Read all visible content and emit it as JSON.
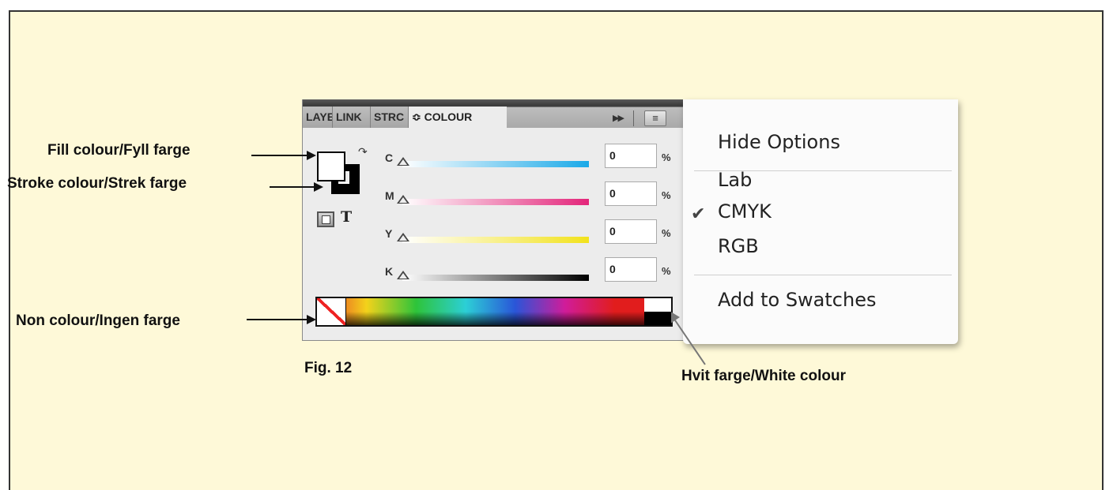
{
  "panel": {
    "tabs": [
      "LAYE",
      "LINK",
      "STRC",
      "≎ COLOUR"
    ],
    "sliders": [
      {
        "label": "C",
        "value": "0",
        "unit": "%",
        "color": "#1aa9e8"
      },
      {
        "label": "M",
        "value": "0",
        "unit": "%",
        "color": "#e3257a"
      },
      {
        "label": "Y",
        "value": "0",
        "unit": "%",
        "color": "#f2e21c"
      },
      {
        "label": "K",
        "value": "0",
        "unit": "%",
        "color": "#000000"
      }
    ]
  },
  "menu": {
    "hide_options": "Hide Options",
    "modes": [
      "Lab",
      "CMYK",
      "RGB"
    ],
    "checked": "CMYK",
    "add_to_swatches": "Add to Swatches"
  },
  "annotations": {
    "fill": "Fill colour/Fyll farge",
    "stroke": "Stroke colour/Strek farge",
    "none": "Non colour/Ingen farge",
    "white": "Hvit farge/White colour",
    "caption": "Fig. 12"
  }
}
